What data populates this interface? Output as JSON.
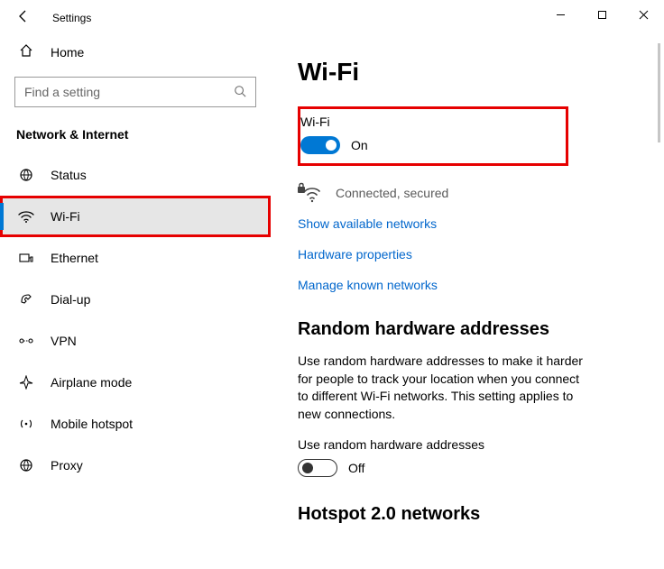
{
  "window": {
    "title": "Settings"
  },
  "sidebar": {
    "home": "Home",
    "search_placeholder": "Find a setting",
    "section": "Network & Internet",
    "items": [
      {
        "label": "Status"
      },
      {
        "label": "Wi-Fi"
      },
      {
        "label": "Ethernet"
      },
      {
        "label": "Dial-up"
      },
      {
        "label": "VPN"
      },
      {
        "label": "Airplane mode"
      },
      {
        "label": "Mobile hotspot"
      },
      {
        "label": "Proxy"
      }
    ]
  },
  "main": {
    "heading": "Wi-Fi",
    "wifi_label": "Wi-Fi",
    "wifi_toggle_state": "On",
    "connection_status": "Connected, secured",
    "links": {
      "show_available": "Show available networks",
      "hardware_props": "Hardware properties",
      "manage_known": "Manage known networks"
    },
    "random_heading": "Random hardware addresses",
    "random_desc": "Use random hardware addresses to make it harder for people to track your location when you connect to different Wi-Fi networks. This setting applies to new connections.",
    "random_toggle_label": "Use random hardware addresses",
    "random_toggle_state": "Off",
    "hotspot_heading": "Hotspot 2.0 networks"
  }
}
